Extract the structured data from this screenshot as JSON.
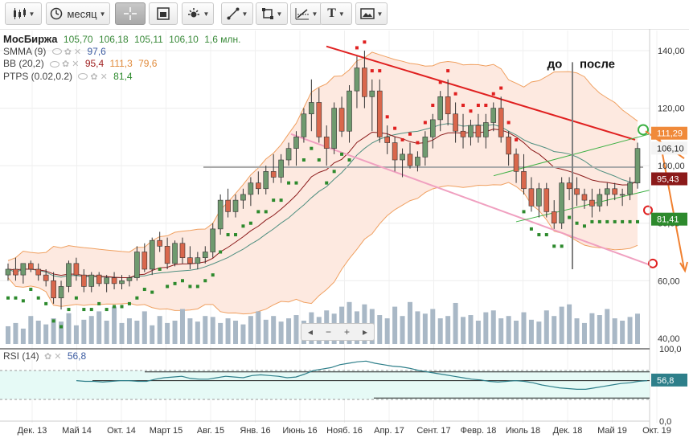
{
  "toolbar": {
    "period_label": "месяц"
  },
  "legend": {
    "title": "МосБиржа",
    "ohlc": [
      "105,70",
      "106,18",
      "105,11",
      "106,10"
    ],
    "volume": "1,6 млн.",
    "smma_label": "SMMA (9)",
    "smma_value": "97,6",
    "bb_label": "BB (20,2)",
    "bb_values": [
      "95,4",
      "111,3",
      "79,6"
    ],
    "ptps_label": "PTPS (0.02,0.2)",
    "ptps_value": "81,4",
    "rsi_label": "RSI (14)",
    "rsi_value": "56,8"
  },
  "annotations": {
    "before": "до",
    "after": "после"
  },
  "price_badges": {
    "upper": "111,29",
    "close": "106,10",
    "middle": "95,43",
    "ptps": "81,41"
  },
  "colors": {
    "up": "#6f9a6f",
    "down": "#d9674c",
    "bb_fill": "#fde9e0",
    "bb_line": "#f0a060",
    "smma": "#8b1a1a",
    "mid": "#4f8f80",
    "ptps": "#2d8a2d",
    "resistance": "#e02020",
    "support": "#f0a0c0",
    "volume": "#a9b8c6"
  },
  "chart_data": [
    {
      "type": "candlestick",
      "title": "МосБиржа",
      "x_ticks": [
        "Дек. 13",
        "Май 14",
        "Окт. 14",
        "Март 15",
        "Авг. 15",
        "Янв. 16",
        "Июнь 16",
        "Нояб. 16",
        "Апр. 17",
        "Сент. 17",
        "Февр. 18",
        "Июль 18",
        "Дек. 18",
        "Май 19",
        "Окт. 19"
      ],
      "y_ticks": [
        40,
        60,
        80,
        100,
        120,
        140
      ],
      "ylim": [
        38,
        147
      ],
      "grid": true,
      "ohlc": [
        [
          62,
          66,
          60,
          64
        ],
        [
          64,
          68,
          60,
          62
        ],
        [
          62,
          66,
          59,
          66
        ],
        [
          66,
          67,
          63,
          64
        ],
        [
          64,
          66,
          60,
          62
        ],
        [
          62,
          64,
          58,
          60
        ],
        [
          60,
          63,
          52,
          54
        ],
        [
          54,
          60,
          50,
          58
        ],
        [
          58,
          67,
          56,
          66
        ],
        [
          66,
          68,
          60,
          62
        ],
        [
          62,
          64,
          56,
          58
        ],
        [
          58,
          63,
          56,
          62
        ],
        [
          62,
          63,
          58,
          59
        ],
        [
          59,
          62,
          56,
          61
        ],
        [
          61,
          63,
          57,
          59
        ],
        [
          59,
          62,
          57,
          60
        ],
        [
          60,
          62,
          58,
          61
        ],
        [
          61,
          72,
          60,
          70
        ],
        [
          70,
          73,
          63,
          64
        ],
        [
          64,
          75,
          62,
          74
        ],
        [
          74,
          77,
          70,
          72
        ],
        [
          72,
          75,
          64,
          66
        ],
        [
          66,
          74,
          65,
          73
        ],
        [
          73,
          75,
          66,
          68
        ],
        [
          68,
          72,
          64,
          66
        ],
        [
          66,
          70,
          64,
          68
        ],
        [
          68,
          72,
          66,
          70
        ],
        [
          70,
          80,
          68,
          78
        ],
        [
          78,
          90,
          76,
          88
        ],
        [
          88,
          92,
          82,
          84
        ],
        [
          84,
          90,
          82,
          88
        ],
        [
          88,
          92,
          85,
          90
        ],
        [
          90,
          96,
          86,
          94
        ],
        [
          94,
          98,
          90,
          92
        ],
        [
          92,
          100,
          90,
          98
        ],
        [
          98,
          104,
          94,
          96
        ],
        [
          96,
          104,
          94,
          102
        ],
        [
          102,
          108,
          100,
          106
        ],
        [
          106,
          112,
          100,
          110
        ],
        [
          110,
          120,
          108,
          118
        ],
        [
          118,
          130,
          112,
          122
        ],
        [
          122,
          127,
          108,
          110
        ],
        [
          110,
          114,
          100,
          106
        ],
        [
          106,
          122,
          104,
          120
        ],
        [
          120,
          124,
          110,
          112
        ],
        [
          112,
          128,
          108,
          126
        ],
        [
          126,
          138,
          120,
          134
        ],
        [
          134,
          140,
          120,
          124
        ],
        [
          124,
          130,
          112,
          126
        ],
        [
          126,
          130,
          108,
          110
        ],
        [
          110,
          114,
          104,
          108
        ],
        [
          108,
          110,
          98,
          102
        ],
        [
          102,
          106,
          96,
          104
        ],
        [
          104,
          108,
          99,
          100
        ],
        [
          100,
          105,
          98,
          103
        ],
        [
          103,
          112,
          100,
          110
        ],
        [
          110,
          118,
          106,
          116
        ],
        [
          116,
          126,
          112,
          124
        ],
        [
          124,
          130,
          114,
          118
        ],
        [
          118,
          122,
          108,
          112
        ],
        [
          112,
          118,
          106,
          110
        ],
        [
          110,
          116,
          107,
          114
        ],
        [
          114,
          118,
          108,
          110
        ],
        [
          110,
          118,
          106,
          115
        ],
        [
          115,
          122,
          112,
          120
        ],
        [
          120,
          124,
          108,
          110
        ],
        [
          110,
          112,
          100,
          104
        ],
        [
          104,
          106,
          94,
          98
        ],
        [
          98,
          104,
          90,
          92
        ],
        [
          92,
          96,
          84,
          86
        ],
        [
          86,
          94,
          82,
          92
        ],
        [
          92,
          94,
          82,
          84
        ],
        [
          84,
          88,
          78,
          80
        ],
        [
          80,
          96,
          78,
          94
        ],
        [
          94,
          96,
          88,
          92
        ],
        [
          92,
          96,
          86,
          90
        ],
        [
          90,
          92,
          85,
          88
        ],
        [
          88,
          92,
          82,
          86
        ],
        [
          86,
          92,
          84,
          90
        ],
        [
          90,
          94,
          86,
          92
        ],
        [
          92,
          94,
          88,
          90
        ],
        [
          90,
          92,
          86,
          90
        ],
        [
          90,
          96,
          88,
          94
        ],
        [
          94,
          108,
          92,
          106
        ]
      ],
      "volume_scale": [
        0.38,
        0.45,
        0.33,
        0.6,
        0.5,
        0.42,
        0.55,
        0.48,
        0.66,
        0.4,
        0.52,
        0.6,
        0.7,
        0.5,
        0.8,
        0.45,
        0.55,
        0.5,
        0.7,
        0.4,
        0.6,
        0.45,
        0.5,
        0.75,
        0.55,
        0.48,
        0.6,
        0.58,
        0.45,
        0.55,
        0.5,
        0.42,
        0.6,
        0.7,
        0.52,
        0.6,
        0.48,
        0.55,
        0.62,
        0.5,
        0.68,
        0.58,
        0.72,
        0.65,
        0.8,
        0.9,
        0.7,
        0.85,
        0.75,
        0.62,
        0.55,
        0.8,
        0.6,
        0.9,
        0.7,
        0.65,
        0.75,
        0.55,
        0.6,
        0.88,
        0.58,
        0.62,
        0.5,
        0.68,
        0.72,
        0.55,
        0.6,
        0.5,
        0.68,
        0.52,
        0.48,
        0.72,
        0.6,
        0.8,
        0.85,
        0.55,
        0.45,
        0.66,
        0.62,
        0.75,
        0.55,
        0.5,
        0.58,
        0.65
      ]
    },
    {
      "type": "line",
      "title": "RSI (14)",
      "y_ticks": [
        0,
        100
      ],
      "ylim": [
        0,
        100
      ],
      "series": [
        {
          "name": "RSI (14)",
          "values": [
            56,
            55,
            55,
            54,
            55,
            56,
            56,
            55,
            55,
            58,
            60,
            61,
            62,
            59,
            58,
            58,
            60,
            62,
            61,
            60,
            63,
            64,
            63,
            62,
            60,
            61,
            65,
            70,
            72,
            74,
            78,
            80,
            82,
            83,
            80,
            78,
            76,
            75,
            73,
            70,
            68,
            66,
            64,
            62,
            60,
            58,
            57,
            55,
            54,
            55,
            56,
            55,
            53,
            50,
            48,
            46,
            45,
            44,
            44,
            46,
            48,
            50,
            52,
            53,
            55,
            56
          ]
        }
      ]
    }
  ]
}
